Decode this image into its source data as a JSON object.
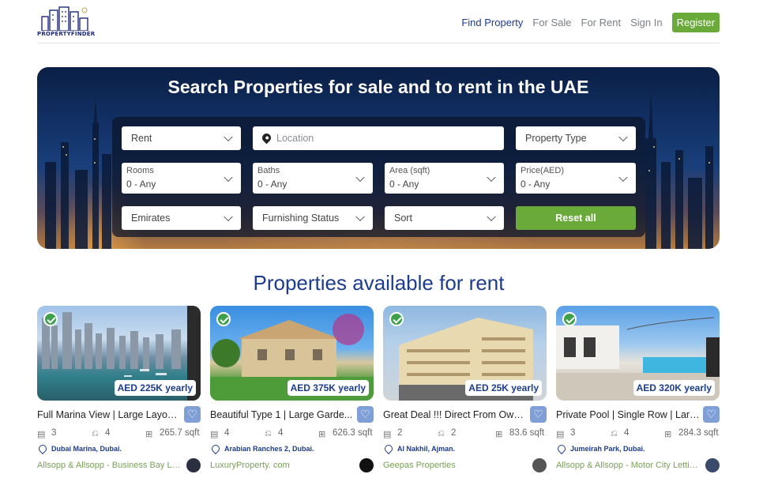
{
  "header": {
    "logo_text": "PROPERTYFINDER",
    "nav": [
      {
        "label": "Find Property",
        "active": true
      },
      {
        "label": "For Sale",
        "active": false
      },
      {
        "label": "For Rent",
        "active": false
      },
      {
        "label": "Sign In",
        "active": false
      }
    ],
    "register_label": "Register"
  },
  "hero": {
    "title": "Search Properties for sale and to rent in the UAE",
    "search": {
      "purpose": "Rent",
      "location_placeholder": "Location",
      "property_type": "Property Type",
      "rooms_label": "Rooms",
      "rooms_value": "0 - Any",
      "baths_label": "Baths",
      "baths_value": "0 - Any",
      "area_label": "Area (sqft)",
      "area_value": "0 - Any",
      "price_label": "Price(AED)",
      "price_value": "0 - Any",
      "emirates": "Emirates",
      "furnishing": "Furnishing Status",
      "sort": "Sort",
      "reset_label": "Reset all"
    }
  },
  "listings": {
    "section_title": "Properties available for rent",
    "cards": [
      {
        "price": "AED 225K yearly",
        "title": "Full Marina View | Large Layout...",
        "beds": "3",
        "baths": "4",
        "area": "265.7 sqft",
        "location": "Dubai Marina, Dubai.",
        "agency": "Allsopp & Allsopp - Business Bay Let..."
      },
      {
        "price": "AED 375K yearly",
        "title": "Beautiful Type 1 | Large Garde...",
        "beds": "4",
        "baths": "4",
        "area": "626.3 sqft",
        "location": "Arabian Ranches 2, Dubai.",
        "agency": "LuxuryProperty. com"
      },
      {
        "price": "AED 25K yearly",
        "title": "Great Deal !!! Direct From Own...",
        "beds": "2",
        "baths": "2",
        "area": "83.6 sqft",
        "location": "Al Nakhil, Ajman.",
        "agency": "Geepas Properties"
      },
      {
        "price": "AED 320K yearly",
        "title": "Private Pool | Single Row | Larg...",
        "beds": "3",
        "baths": "4",
        "area": "284.3 sqft",
        "location": "Jumeirah Park, Dubai.",
        "agency": "Allsopp & Allsopp - Motor City Lettin..."
      }
    ]
  },
  "colors": {
    "brand_blue": "#1c3c8c",
    "accent_green": "#6aaa3a",
    "verified_green": "#3ea04a",
    "fav_blue": "#7f9fd6"
  }
}
